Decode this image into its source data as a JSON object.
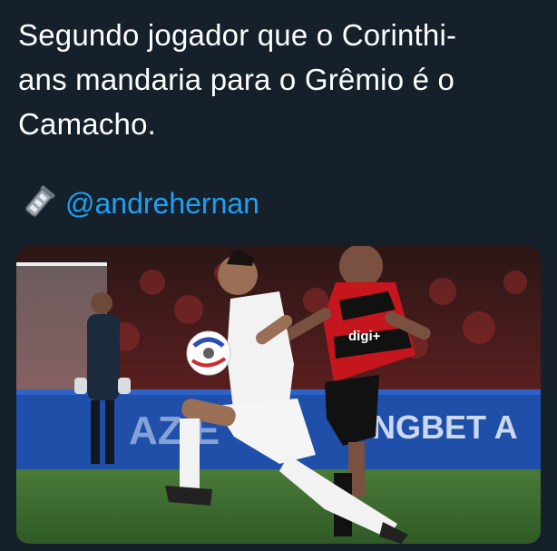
{
  "tweet": {
    "text": "Segundo jogador que o Corinthi-\nans mandaria para o Grêmio é o\nCamacho.",
    "emoji_icon": "film-camera-icon",
    "mention": "@andrehernan"
  },
  "media": {
    "description_icon": "photo",
    "banner_left": "AZ E",
    "banner_right": "NGBET A",
    "jersey_sponsor": "digi+",
    "colors": {
      "background": "#15202b",
      "mention": "#1da1f2",
      "pitch": "#3a6b2f",
      "banner": "#1f4fa8",
      "jersey_red": "#c4161c",
      "jersey_black": "#111111"
    }
  }
}
